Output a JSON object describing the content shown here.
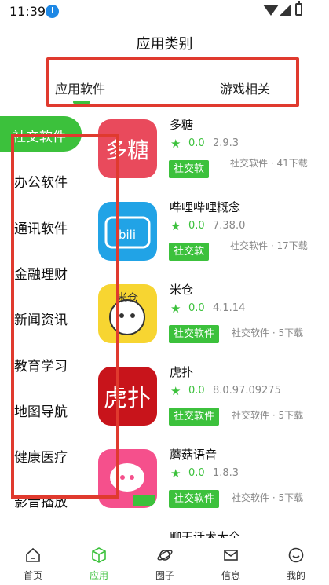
{
  "status_bar": {
    "time": "11:39"
  },
  "header": {
    "title": "应用类别"
  },
  "top_tabs": [
    {
      "label": "应用软件",
      "active": true
    },
    {
      "label": "游戏相关",
      "active": false
    }
  ],
  "categories": {
    "active": "社交软件",
    "items": [
      "办公软件",
      "通讯软件",
      "金融理财",
      "新闻资讯",
      "教育学习",
      "地图导航",
      "健康医疗",
      "影音播放"
    ]
  },
  "apps": [
    {
      "name": "多糖",
      "rating": "0.0",
      "version": "2.9.3",
      "tag": "社交软",
      "meta": "社交软件 · 41下载",
      "icon": "duotang-icon",
      "icon_color": "#e94a5c"
    },
    {
      "name": "哔哩哔哩概念",
      "rating": "0.0",
      "version": "7.38.0",
      "tag": "社交软",
      "meta": "社交软件 · 17下载",
      "icon": "bilibili-icon",
      "icon_color": "#21a3e6"
    },
    {
      "name": "米仓",
      "rating": "0.0",
      "version": "4.1.14",
      "tag": "社交软件",
      "meta": "社交软件 · 5下载",
      "icon": "micang-icon",
      "icon_color": "#f7d531"
    },
    {
      "name": "虎扑",
      "rating": "0.0",
      "version": "8.0.97.09275",
      "tag": "社交软件",
      "meta": "社交软件 · 5下载",
      "icon": "hupu-icon",
      "icon_color": "#c8141b"
    },
    {
      "name": "蘑菇语音",
      "rating": "0.0",
      "version": "1.8.3",
      "tag": "社交软件",
      "meta": "社交软件 · 5下载",
      "icon": "mogu-icon",
      "icon_color": "#f5508c"
    },
    {
      "name": "聊天话术大全",
      "rating": "",
      "version": "",
      "tag": "",
      "meta": "",
      "icon": "chat-icon",
      "icon_color": "#ec5ca2"
    }
  ],
  "bottom_nav": [
    {
      "label": "首页",
      "icon": "home-icon",
      "active": false
    },
    {
      "label": "应用",
      "icon": "cube-icon",
      "active": true
    },
    {
      "label": "圈子",
      "icon": "planet-icon",
      "active": false
    },
    {
      "label": "信息",
      "icon": "mail-icon",
      "active": false
    },
    {
      "label": "我的",
      "icon": "smile-icon",
      "active": false
    }
  ],
  "colors": {
    "accent": "#3cc13c",
    "highlight_box": "#e03a2e"
  }
}
